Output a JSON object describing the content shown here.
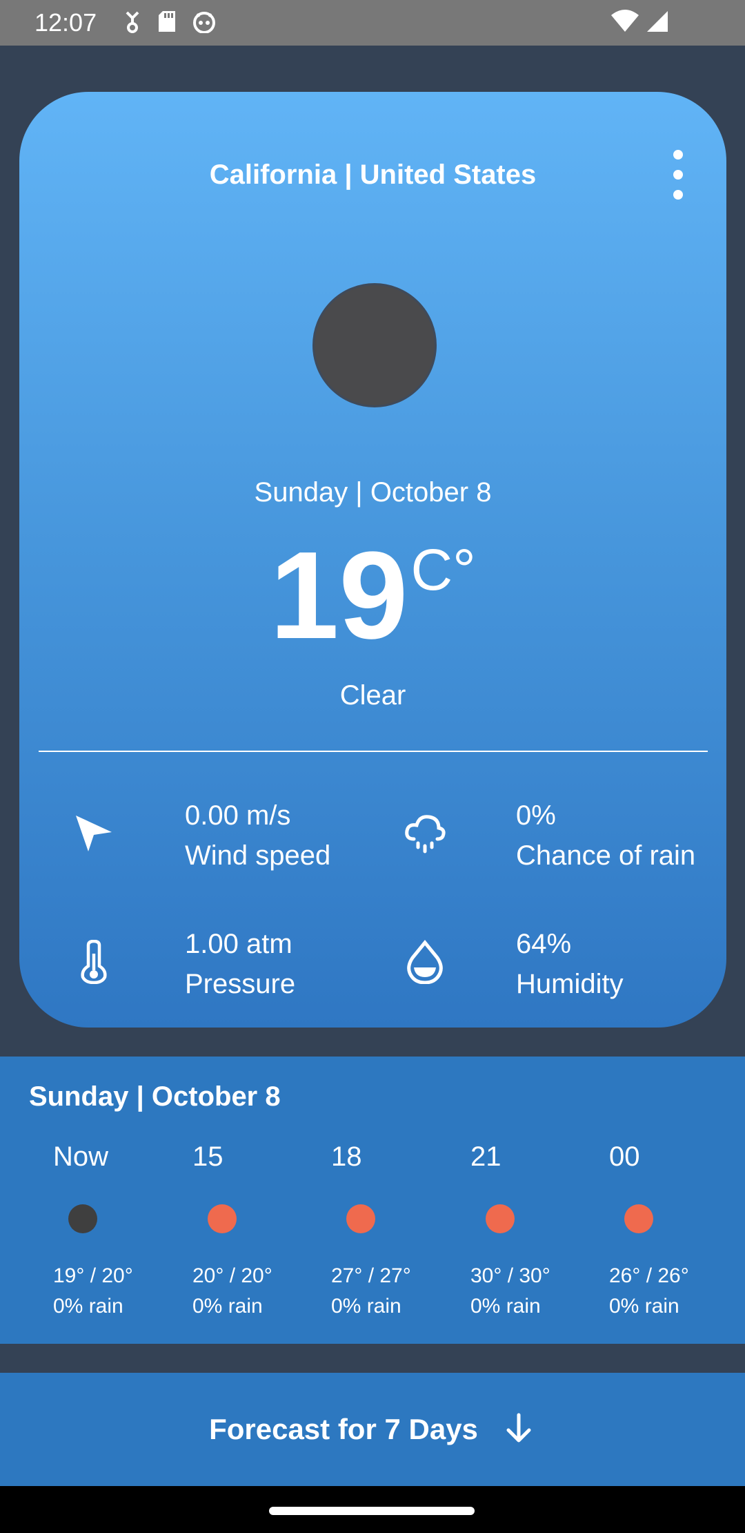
{
  "status_bar": {
    "time": "12:07",
    "left_icons": [
      "usb-debug-icon",
      "sd-card-icon",
      "android-icon"
    ],
    "right_icons": [
      "wifi-icon",
      "cell-signal-icon"
    ]
  },
  "header": {
    "location": "California | United States",
    "menu_icon": "more-vert-icon"
  },
  "current": {
    "date": "Sunday | October 8",
    "temperature": "19",
    "unit": "C°",
    "condition": "Clear",
    "icon_color": "#4a4a4c"
  },
  "stats": [
    {
      "icon": "navigation-arrow-icon",
      "value": "0.00 m/s",
      "label": "Wind speed"
    },
    {
      "icon": "rain-cloud-icon",
      "value": "0%",
      "label": "Chance of rain"
    },
    {
      "icon": "thermometer-icon",
      "value": "1.00 atm",
      "label": "Pressure"
    },
    {
      "icon": "water-drop-icon",
      "value": "64%",
      "label": "Humidity"
    }
  ],
  "hourly": {
    "title": "Sunday | October 8",
    "items": [
      {
        "time": "Now",
        "temps": "19° / 20°",
        "rain": "0% rain",
        "dot_color": "#3f3f3f"
      },
      {
        "time": "15",
        "temps": "20° / 20°",
        "rain": "0% rain",
        "dot_color": "#ef6a4e"
      },
      {
        "time": "18",
        "temps": "27° / 27°",
        "rain": "0% rain",
        "dot_color": "#ef6a4e"
      },
      {
        "time": "21",
        "temps": "30° / 30°",
        "rain": "0% rain",
        "dot_color": "#ef6a4e"
      },
      {
        "time": "00",
        "temps": "26° / 26°",
        "rain": "0% rain",
        "dot_color": "#ef6a4e"
      }
    ]
  },
  "forecast_button": {
    "label": "Forecast for 7 Days",
    "icon": "arrow-down-icon"
  },
  "colors": {
    "background": "#344255",
    "card_top": "#61b4f6",
    "card_bottom": "#2f77c3",
    "panel": "#2d78c0"
  }
}
